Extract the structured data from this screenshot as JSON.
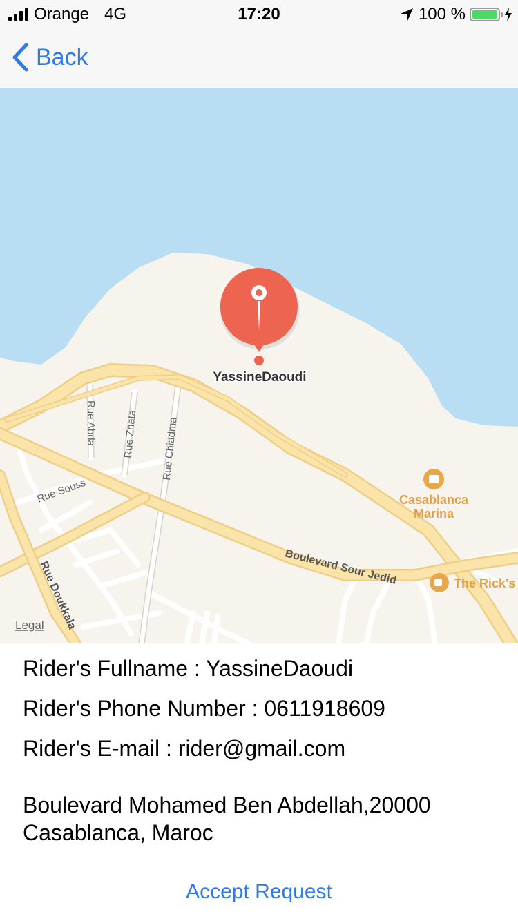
{
  "status_bar": {
    "carrier": "Orange",
    "network": "4G",
    "time": "17:20",
    "battery_percent": "100 %",
    "battery_level": 1.0
  },
  "nav": {
    "back_label": "Back"
  },
  "map": {
    "pin_label": "YassineDaoudi",
    "streets": {
      "rue_abda": "Rue Abda",
      "rue_znata": "Rue Znata",
      "rue_chiadma": "Rue Chiadma",
      "rue_souss": "Rue Souss",
      "rue_doukkala": "Rue Doukkala",
      "boulevard_sour_jedid": "Boulevard Sour Jedid"
    },
    "poi": {
      "marina_line1": "Casablanca",
      "marina_line2": "Marina",
      "ricks": "The Rick's"
    },
    "legal_label": "Legal",
    "colors": {
      "water": "#b9ddf2",
      "land": "#f7f4ee",
      "road": "#f9e3a8",
      "pin": "#ed6550",
      "poi": "#e39f45"
    }
  },
  "rider": {
    "fullname": "Rider's Fullname : YassineDaoudi",
    "phone": "Rider's Phone Number : 0611918609",
    "email": "Rider's E-mail : rider@gmail.com"
  },
  "address": {
    "line1": "Boulevard Mohamed Ben Abdellah,20000",
    "line2": "Casablanca, Maroc"
  },
  "actions": {
    "accept_label": "Accept Request"
  }
}
